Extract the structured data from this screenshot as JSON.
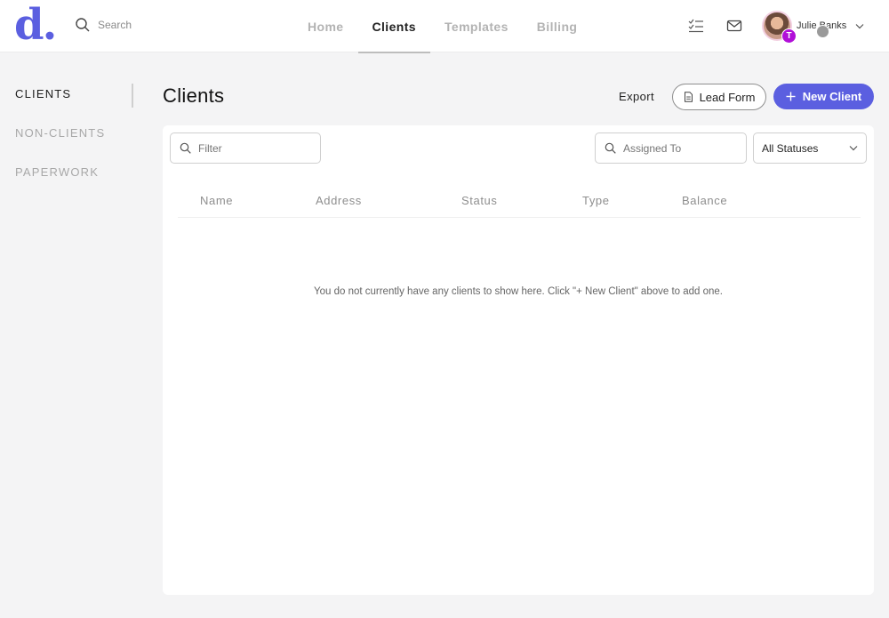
{
  "app": {
    "logo_letter": "d",
    "logo_dot": "."
  },
  "search": {
    "label": "Search"
  },
  "nav": {
    "home": "Home",
    "clients": "Clients",
    "templates": "Templates",
    "billing": "Billing"
  },
  "user": {
    "name": "Julie Banks",
    "badge": "T"
  },
  "sidebar": {
    "clients": "CLIENTS",
    "non_clients": "NON-CLIENTS",
    "paperwork": "PAPERWORK"
  },
  "main": {
    "title": "Clients",
    "export_label": "Export",
    "lead_form_label": "Lead Form",
    "new_client_label": "New Client"
  },
  "filters": {
    "filter_placeholder": "Filter",
    "assigned_placeholder": "Assigned To",
    "status_value": "All Statuses"
  },
  "table": {
    "columns": [
      "Name",
      "Address",
      "Status",
      "Type",
      "Balance"
    ],
    "empty_message": "You do not currently have any clients to show here. Click \"+ New Client\" above to add one."
  },
  "colors": {
    "accent": "#5b5fe0",
    "badge": "#b10fd8"
  }
}
